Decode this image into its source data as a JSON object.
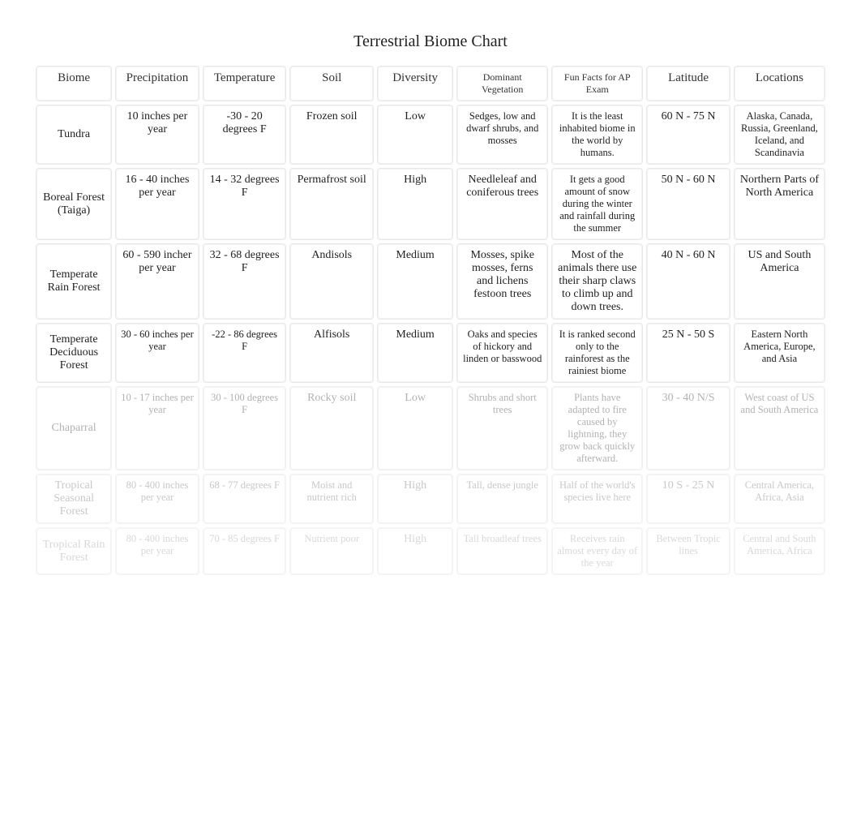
{
  "title": "Terrestrial Biome Chart",
  "headers": [
    "Biome",
    "Precipitation",
    "Temperature",
    "Soil",
    "Diversity",
    "Dominant Vegetation",
    "Fun Facts for AP Exam",
    "Latitude",
    "Locations"
  ],
  "rows": [
    {
      "biome": "Tundra",
      "precip": "10 inches per year",
      "temp": "-30 - 20 degrees F",
      "soil": "Frozen soil",
      "diversity": "Low",
      "vegetation": "Sedges, low and dwarf shrubs, and mosses",
      "fact": "It is the least inhabited biome in the world by humans.",
      "latitude": "60 N - 75 N",
      "locations": "Alaska, Canada, Russia, Greenland, Iceland, and Scandinavia"
    },
    {
      "biome": "Boreal Forest (Taiga)",
      "precip": "16 - 40 inches per year",
      "temp": "14 - 32 degrees F",
      "soil": "Permafrost soil",
      "diversity": "High",
      "vegetation": "Needleleaf and coniferous trees",
      "fact": "It gets a good amount of snow during the winter and rainfall during the summer",
      "latitude": "50 N - 60 N",
      "locations": "Northern Parts of North America"
    },
    {
      "biome": "Temperate Rain Forest",
      "precip": "60 - 590 incher per year",
      "temp": "32 - 68 degrees F",
      "soil": "Andisols",
      "diversity": "Medium",
      "vegetation": "Mosses, spike mosses, ferns and lichens festoon trees",
      "fact": "Most of the animals there use their sharp claws to climb up and down trees.",
      "latitude": "40 N - 60 N",
      "locations": "US and South America"
    },
    {
      "biome": "Temperate Deciduous Forest",
      "precip": "30 - 60 inches per year",
      "temp": "-22 - 86 degrees F",
      "soil": "Alfisols",
      "diversity": "Medium",
      "vegetation": "Oaks and species of hickory and linden or basswood",
      "fact": "It is ranked second only to the rainforest as the rainiest biome",
      "latitude": "25 N - 50 S",
      "locations": "Eastern North America, Europe, and Asia"
    },
    {
      "biome": "Chaparral",
      "precip": "10 - 17 inches per year",
      "temp": "30 - 100 degrees F",
      "soil": "Rocky soil",
      "diversity": "Low",
      "vegetation": "Shrubs and short trees",
      "fact": "Plants have adapted to fire caused by lightning, they grow back quickly afterward.",
      "latitude": "30 - 40 N/S",
      "locations": "West coast of US and South America",
      "fade": "fade-3"
    },
    {
      "biome": "Tropical Seasonal Forest",
      "precip": "80 - 400 inches per year",
      "temp": "68 - 77 degrees F",
      "soil": "Moist and nutrient rich",
      "diversity": "High",
      "vegetation": "Tall, dense jungle",
      "fact": "Half of the world's species live here",
      "latitude": "10 S - 25 N",
      "locations": "Central America, Africa, Asia",
      "fade": "fade-2"
    },
    {
      "biome": "Tropical Rain Forest",
      "precip": "80 - 400 inches per year",
      "temp": "70 - 85 degrees F",
      "soil": "Nutrient poor",
      "diversity": "High",
      "vegetation": "Tall broadleaf trees",
      "fact": "Receives rain almost every day of the year",
      "latitude": "Between Tropic lines",
      "locations": "Central and South America, Africa",
      "fade": "fade-1"
    }
  ]
}
